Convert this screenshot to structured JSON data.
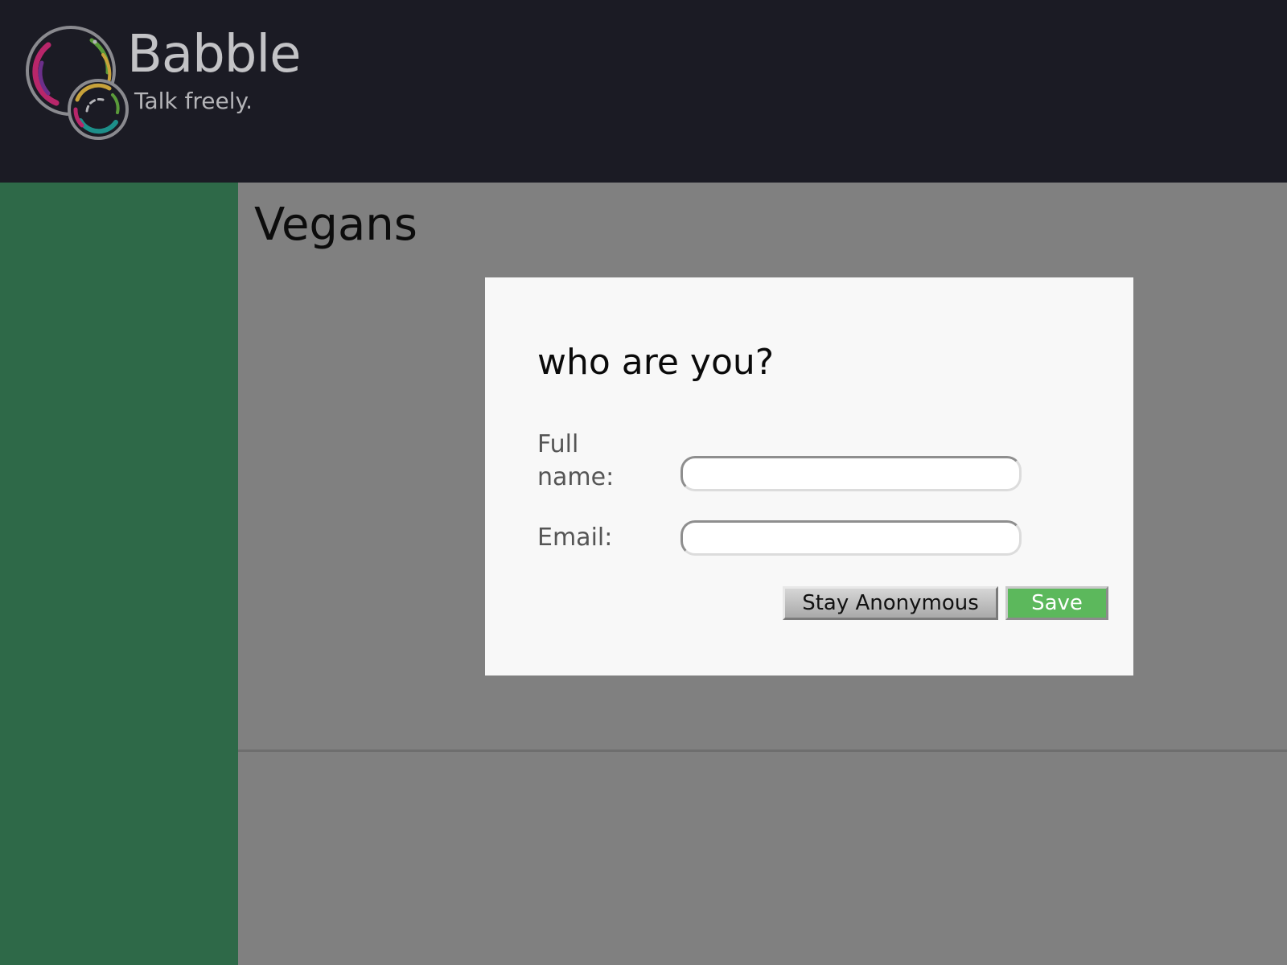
{
  "app": {
    "name": "Babble",
    "tagline": "Talk freely.",
    "colors": {
      "header_bg": "#1b1b24",
      "sidebar_bg": "#2e6948",
      "main_bg": "#808080",
      "save_button": "#5cb85c"
    }
  },
  "room": {
    "title": "Vegans"
  },
  "modal": {
    "title": "who are you?",
    "fields": {
      "full_name": {
        "label": "Full name:",
        "value": "",
        "placeholder": ""
      },
      "email": {
        "label": "Email:",
        "value": "",
        "placeholder": ""
      }
    },
    "buttons": {
      "anonymous": "Stay Anonymous",
      "save": "Save"
    }
  }
}
